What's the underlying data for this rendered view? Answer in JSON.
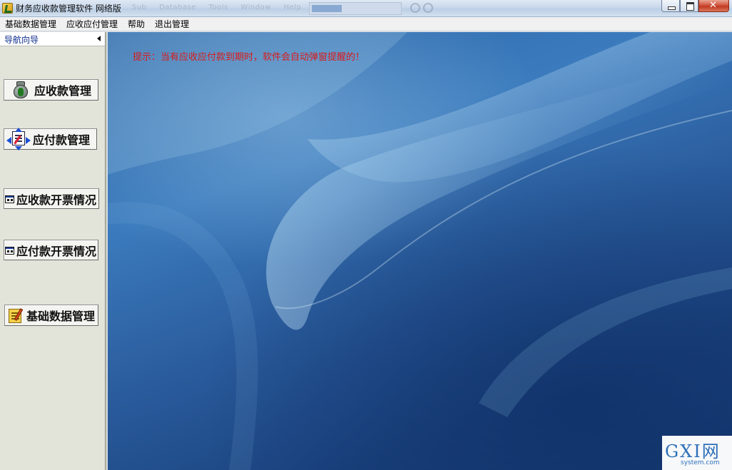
{
  "window": {
    "title": "财务应收款管理软件  网络版",
    "background_menu_labels": [
      "Sub",
      "Database",
      "Tools",
      "Window",
      "Help"
    ]
  },
  "menubar": {
    "items": [
      "基础数据管理",
      "应收应付管理",
      "帮助",
      "退出管理"
    ]
  },
  "nav": {
    "header": "导航向导",
    "buttons": [
      {
        "label": "应收款管理",
        "icon": "money-bag-icon"
      },
      {
        "label": "应付款管理",
        "icon": "payment-transfer-icon"
      },
      {
        "label": "应收款开票情况",
        "icon": "invoice-window-icon"
      },
      {
        "label": "应付款开票情况",
        "icon": "invoice-window-icon"
      },
      {
        "label": "基础数据管理",
        "icon": "edit-document-icon"
      }
    ]
  },
  "main": {
    "tip": "提示：当有应收应付款到期时，软件会自动弹窗提醒的！"
  },
  "watermark": {
    "main": "GXI网",
    "sub": "system.com"
  },
  "colors": {
    "tip_text": "#d81b1b",
    "nav_background": "#e3e4d9",
    "desktop_blue": "#2a64a6"
  }
}
